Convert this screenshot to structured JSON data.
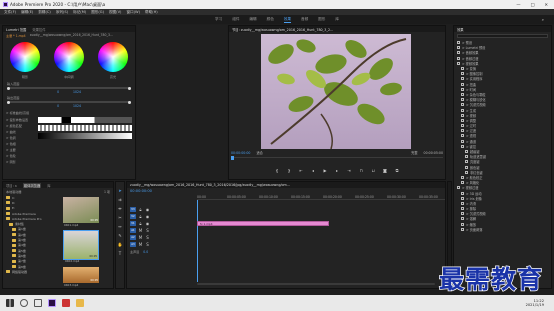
{
  "title_bar": {
    "app_title": "Adobe Premiere Pro 2020 - C:\\用户\\Mac\\桌面\\a",
    "minimize": "—",
    "maximize": "□",
    "close": "✕"
  },
  "menu": {
    "items": [
      "文件(F)",
      "编辑(E)",
      "剪辑(C)",
      "序列(S)",
      "标记(M)",
      "图形(G)",
      "视图(V)",
      "窗口(W)",
      "帮助(H)"
    ]
  },
  "workspaces": {
    "items": [
      "学习",
      "组件",
      "编辑",
      "颜色",
      "效果",
      "音频",
      "图形",
      "库"
    ],
    "active": "效果"
  },
  "lumetri_panel": {
    "tab1": "Lumetri 范围",
    "tab2": "效果控件",
    "tab3": "Lumetri 颜色",
    "source_label": "主要 * 1.mp4",
    "clip_label": "zuodiy__mg/wosuowng/om_2016_2016_Hunt_780_3...",
    "wheel_labels": [
      "阴影",
      "中间调",
      "高光"
    ],
    "slider1_label": "输入范围",
    "slider1_values": [
      "0",
      "1024"
    ],
    "slider2_label": "输出范围",
    "slider2_values": [
      "0",
      "1024"
    ],
    "section_label": "> 标准曲线/高级",
    "left_labels": [
      "> 晕影参数设置",
      "> 颜色匹配",
      "> 曲线",
      "> 色调",
      "> 色相",
      "> 主要",
      "> 色轮",
      "> 阴影"
    ]
  },
  "program_monitor": {
    "title": "节目: zuodiy__mg/wosuowng/om_2016_2016_Hunt_780_3_2...",
    "timecode_left": "00:00:00:00",
    "fit": "适合",
    "quality": "完整",
    "timecode_right": "00:00:05:00"
  },
  "transport": {
    "buttons": [
      "mark-in",
      "mark-out",
      "go-to-in",
      "step-back",
      "play",
      "step-forward",
      "go-to-out",
      "insert",
      "overwrite",
      "export-frame",
      "compare"
    ]
  },
  "project_panel": {
    "tab1": "项目: a",
    "tab2": "媒体浏览器",
    "tab3": "库",
    "count_label": "1 项",
    "drive_label": "本地驱动器",
    "tree": [
      "C:",
      "D:",
      "E:",
      "Adobe Premiere",
      "Adobe Premiere Pro",
      "素材集",
      "第1章",
      "第2章",
      "第3章",
      "第4章",
      "第5章",
      "第6章",
      "第7章",
      "第8章",
      "网络驱动器"
    ],
    "thumbs": [
      "0401.mp4",
      "0402.mp4",
      "0403.mp4"
    ],
    "thumb_durations": [
      "00:05",
      "00:05",
      "00:05"
    ]
  },
  "timeline": {
    "sequence_title": "zuodiy__mg/wosuowng/om_2016_2016_Hunt_780_3_2016/2016/jpg/zuodiy__mg/wosuowng/om...",
    "timecode": "00:00:00:00",
    "ruler_marks": [
      "00:00",
      "00:00:05:00",
      "00:00:10:00",
      "00:00:15:00",
      "00:00:20:00",
      "00:00:25:00",
      "00:00:30:00",
      "00:00:35:00"
    ],
    "tracks": [
      "V3",
      "V2",
      "V1",
      "A1",
      "A2",
      "A3"
    ],
    "clip_label": "fx 1.mp4",
    "master_label": "主声道",
    "master_value": "0.0"
  },
  "effects_panel": {
    "tab": "效果",
    "items": [
      "> 预设",
      "> Lumetri 预设",
      "> 音频效果",
      "> 音频过渡",
      "> 视频效果",
      "  > 变换",
      "  > 图像控制",
      "  > 实用程序",
      "  > 扭曲",
      "  > 时间",
      "  > 杂色与颗粒",
      "  > 模糊与锐化",
      "  > 沉浸式视频",
      "  > 生成",
      "  > 视频",
      "  > 调整",
      "  > 过时",
      "  > 过渡",
      "  > 透视",
      "  > 通道",
      "  > 键控",
      "    超级键",
      "    轨道遮罩键",
      "    亮度键",
      "    颜色键",
      "    非红色键",
      "  > 颜色校正",
      "  > 风格化",
      "> 视频过渡",
      "  > 3D 运动",
      "  > Iris 划像",
      "  > 内滑",
      "  > 擦除",
      "  > 沉浸式视频",
      "  > 溶解",
      "  > 缩放",
      "  > 页面剥落"
    ]
  },
  "watermark": {
    "text": "最需教育"
  },
  "taskbar": {
    "time": "11:22",
    "date": "2021/1/19"
  },
  "colors": {
    "accent": "#4a9ff0",
    "clip": "#e58ad2",
    "watermark": "#1a33a8"
  }
}
